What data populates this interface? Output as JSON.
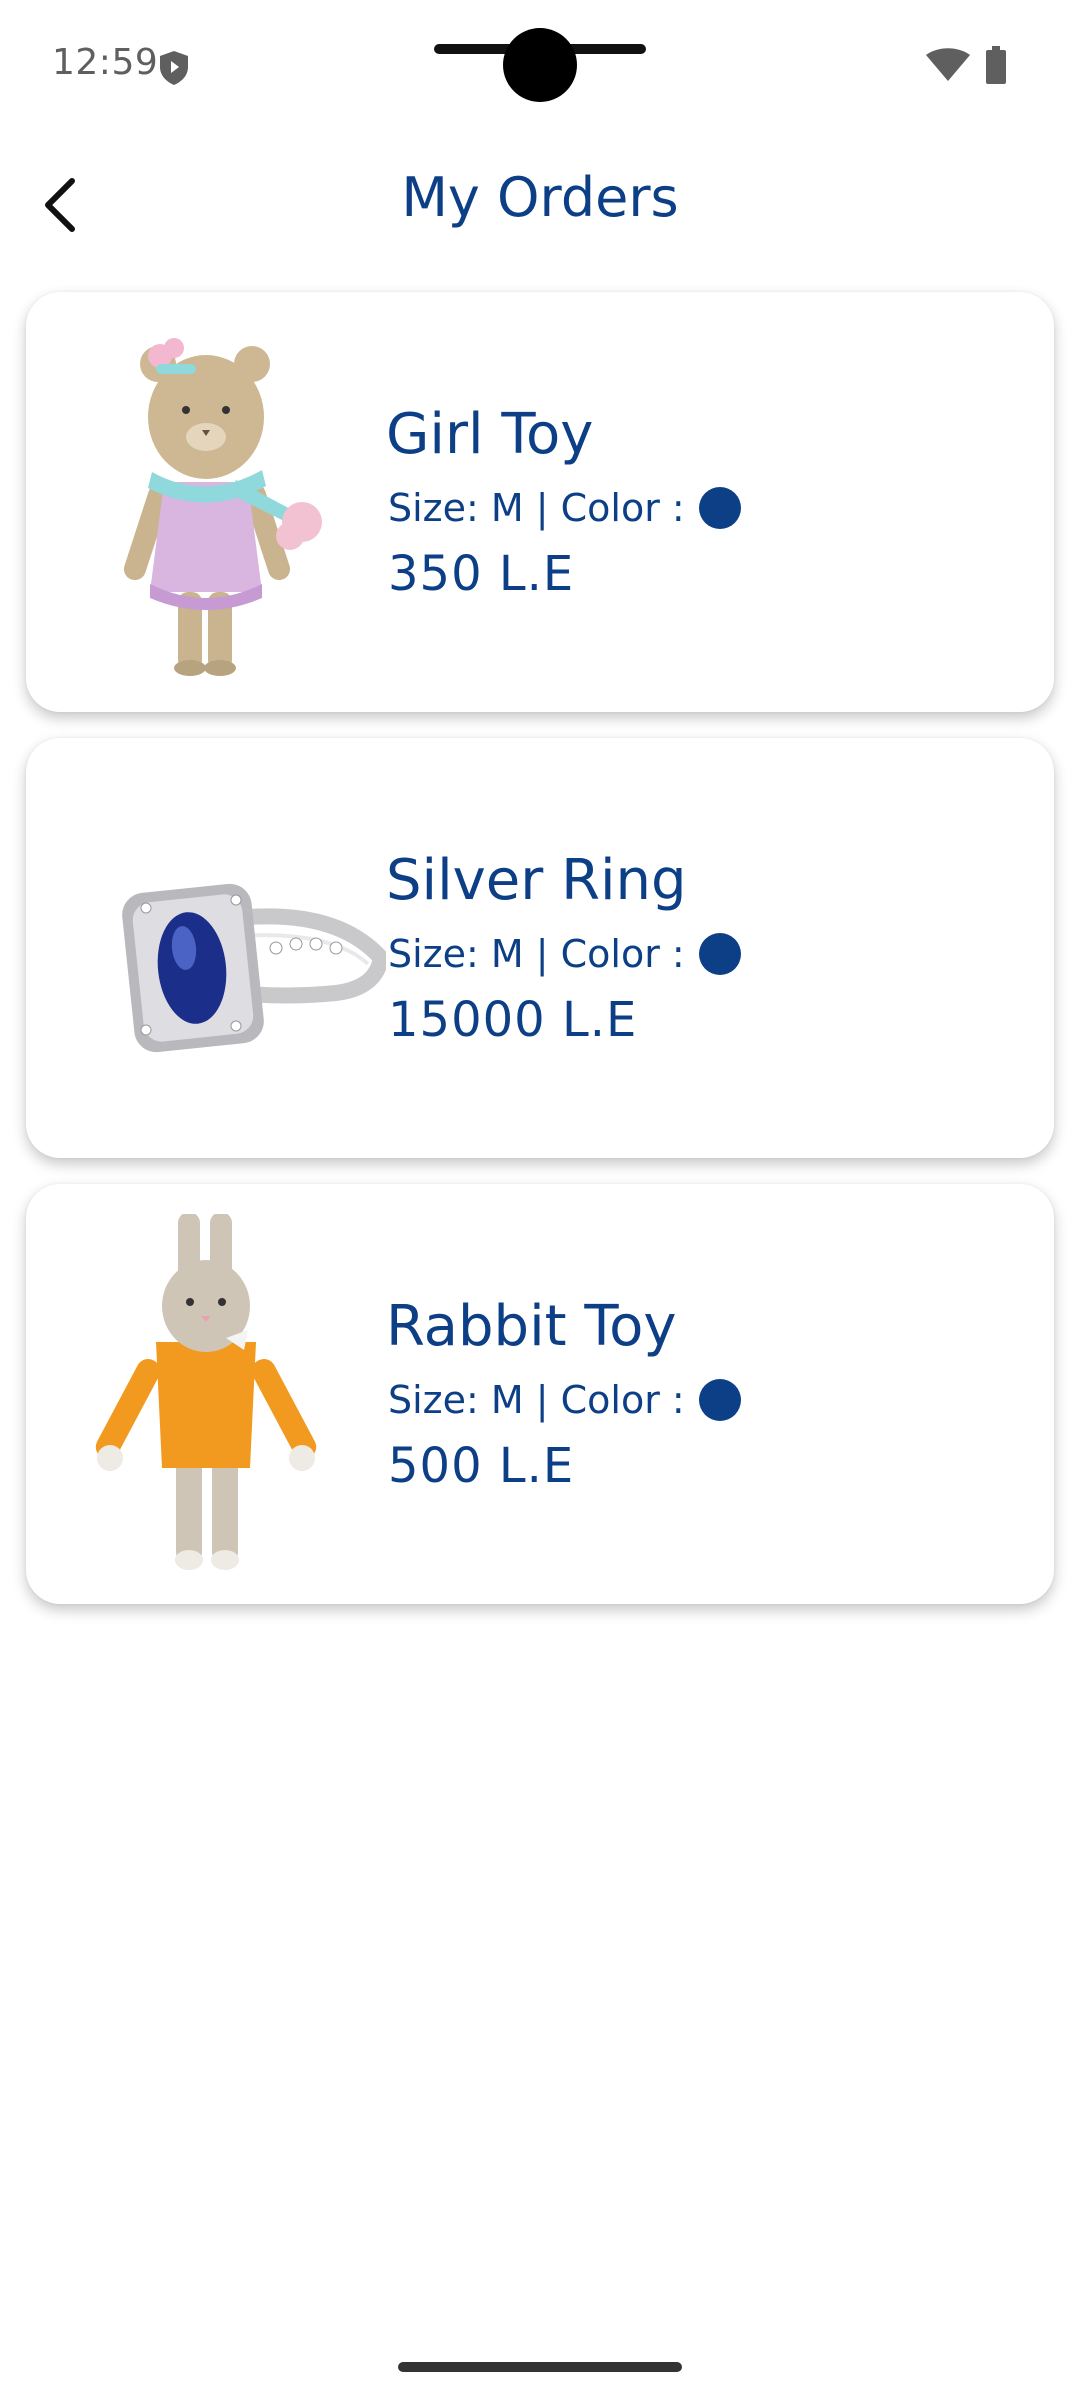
{
  "status_bar": {
    "time": "12:59"
  },
  "header": {
    "title": "My Orders"
  },
  "orders": [
    {
      "name": "Girl Toy",
      "meta": "Size: M | Color :",
      "price": "350 L.E",
      "color_swatch": "#0d3f87"
    },
    {
      "name": "Silver Ring",
      "meta": "Size: M | Color :",
      "price": "15000 L.E",
      "color_swatch": "#0d3f87"
    },
    {
      "name": "Rabbit Toy",
      "meta": "Size: M | Color :",
      "price": "500 L.E",
      "color_swatch": "#0d3f87"
    }
  ],
  "icons": [
    "shield-icon",
    "wifi-icon",
    "battery-icon",
    "back-arrow-icon"
  ],
  "colors": {
    "accent": "#0d3f87",
    "background": "#ffffff"
  }
}
